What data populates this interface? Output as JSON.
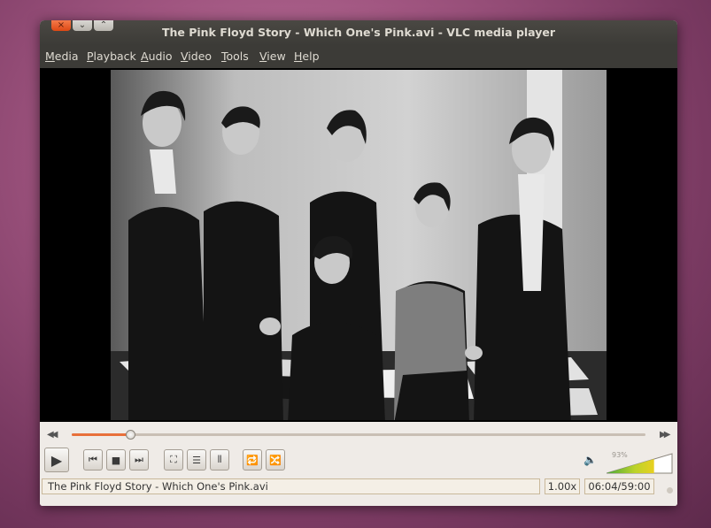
{
  "window": {
    "title": "The Pink Floyd Story - Which One's Pink.avi - VLC media player"
  },
  "window_controls": {
    "close": "×",
    "minimize": "⌄",
    "maximize": "⌃"
  },
  "menu": [
    "Media",
    "Playback",
    "Audio",
    "Video",
    "Tools",
    "View",
    "Help"
  ],
  "seek": {
    "progress_fraction": 0.102
  },
  "controls": {
    "play": "▶",
    "prev": "⏮",
    "stop": "■",
    "next": "⏭",
    "fullscreen": "⛶",
    "playlist": "☰",
    "extended": "⫴",
    "loop": "🔁",
    "random": "🔀",
    "seek_back": "◀◀",
    "seek_forward": "▶▶"
  },
  "volume": {
    "label": "93%",
    "level_fraction": 0.93
  },
  "status": {
    "filename": "The Pink Floyd Story - Which One's Pink.avi",
    "rate": "1.00x",
    "time": "06:04/59:00"
  },
  "icons": [
    "close-icon",
    "minimize-icon",
    "maximize-icon",
    "play-icon",
    "previous-icon",
    "stop-icon",
    "next-icon",
    "fullscreen-icon",
    "playlist-icon",
    "equalizer-icon",
    "loop-icon",
    "random-icon",
    "volume-icon"
  ]
}
